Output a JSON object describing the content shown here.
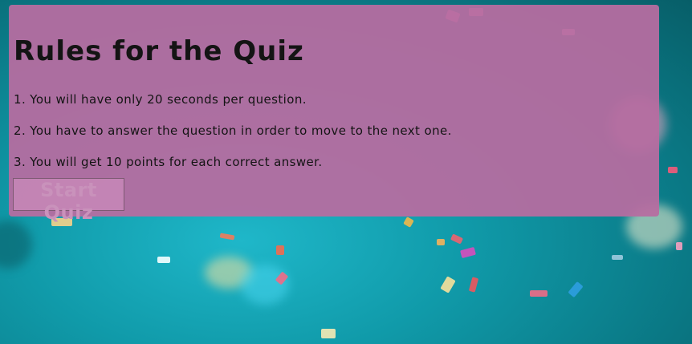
{
  "rules_card": {
    "title": "Rules for the Quiz",
    "rules": [
      "1. You will have only 20 seconds per question.",
      "2. You have to answer the question in order to move to the next one.",
      "3. You will get 10 points for each correct answer."
    ],
    "start_button_label": "Start Quiz"
  },
  "colors": {
    "card_background": "#b76ca0",
    "page_background": "#109aa9",
    "text": "#141414",
    "button_text": "#c992bb"
  }
}
